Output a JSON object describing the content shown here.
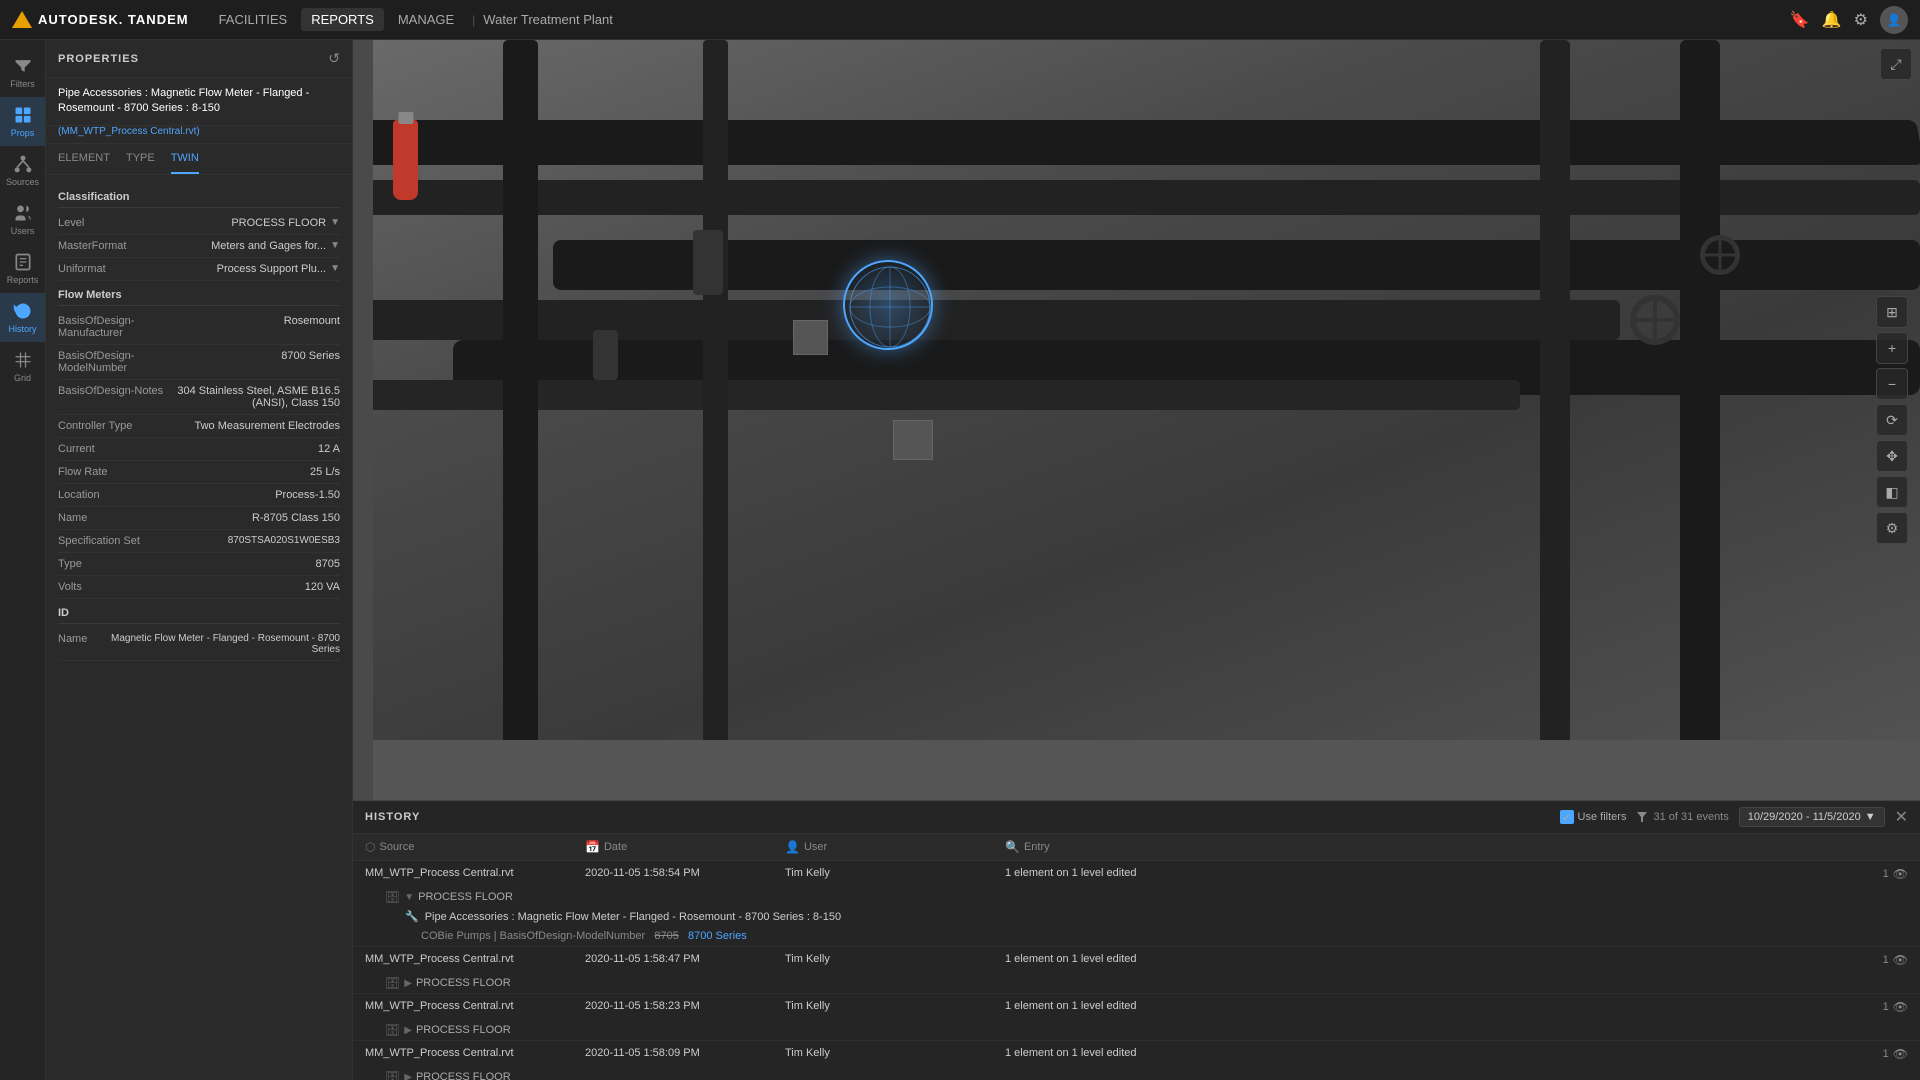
{
  "app": {
    "logo": "AUTODESK. TANDEM",
    "nav_links": [
      {
        "label": "FACILITIES",
        "active": false
      },
      {
        "label": "REPORTS",
        "active": false
      },
      {
        "label": "MANAGE",
        "active": false
      }
    ],
    "facility_name": "Water Treatment Plant"
  },
  "sidebar": {
    "items": [
      {
        "label": "Filters",
        "icon": "filter-icon",
        "active": false
      },
      {
        "label": "Props",
        "icon": "props-icon",
        "active": true
      },
      {
        "label": "Sources",
        "icon": "sources-icon",
        "active": false
      },
      {
        "label": "Users",
        "icon": "users-icon",
        "active": false
      },
      {
        "label": "Reports",
        "icon": "reports-icon",
        "active": false
      },
      {
        "label": "History",
        "icon": "history-icon",
        "active": true
      },
      {
        "label": "Grid",
        "icon": "grid-icon",
        "active": false
      }
    ]
  },
  "properties": {
    "panel_title": "PROPERTIES",
    "element_name": "Pipe Accessories : Magnetic Flow Meter - Flanged - Rosemount - 8700 Series : 8-150",
    "file_name": "(MM_WTP_Process Central.rvt)",
    "tabs": [
      "ELEMENT",
      "TYPE",
      "TWIN"
    ],
    "active_tab": "TWIN",
    "sections": [
      {
        "title": "Classification",
        "fields": [
          {
            "label": "Level",
            "value": "PROCESS FLOOR",
            "dropdown": true
          },
          {
            "label": "MasterFormat",
            "value": "Meters and Gages for...",
            "dropdown": true
          },
          {
            "label": "Uniformat",
            "value": "Process Support Plu...",
            "dropdown": true
          }
        ]
      },
      {
        "title": "Flow Meters",
        "fields": [
          {
            "label": "BasisOfDesign-Manufacturer",
            "value": "Rosemount",
            "dropdown": false
          },
          {
            "label": "BasisOfDesign-ModelNumber",
            "value": "8700 Series",
            "dropdown": false
          },
          {
            "label": "BasisOfDesign-Notes",
            "value": "304 Stainless Steel, ASME B16.5 (ANSI), Class 150",
            "dropdown": false
          },
          {
            "label": "Controller Type",
            "value": "Two Measurement Electrodes",
            "dropdown": false
          },
          {
            "label": "Current",
            "value": "12 A",
            "dropdown": false
          },
          {
            "label": "Flow Rate",
            "value": "25 L/s",
            "dropdown": false
          },
          {
            "label": "Location",
            "value": "Process-1.50",
            "dropdown": false
          },
          {
            "label": "Name",
            "value": "R-8705 Class 150",
            "dropdown": false
          },
          {
            "label": "Specification Set",
            "value": "870STSA020S1W0ESB3",
            "dropdown": false
          },
          {
            "label": "Type",
            "value": "8705",
            "dropdown": false
          },
          {
            "label": "Volts",
            "value": "120 VA",
            "dropdown": false
          }
        ]
      },
      {
        "title": "ID",
        "fields": [
          {
            "label": "Name",
            "value": "Magnetic Flow Meter - Flanged - Rosemount - 8700 Series",
            "dropdown": false
          }
        ]
      }
    ]
  },
  "history": {
    "panel_title": "HISTORY",
    "use_filters_label": "Use filters",
    "events_count": "31 of 31 events",
    "date_range": "10/29/2020 - 11/5/2020",
    "columns": [
      {
        "label": "Source",
        "icon": "source-col-icon"
      },
      {
        "label": "Date",
        "icon": "date-col-icon"
      },
      {
        "label": "User",
        "icon": "user-col-icon"
      },
      {
        "label": "Entry",
        "icon": "search-col-icon"
      }
    ],
    "rows": [
      {
        "source": "MM_WTP_Process Central.rvt",
        "date": "2020-11-05 1:58:54 PM",
        "user": "Tim Kelly",
        "entry": "1 element on 1 level edited",
        "count": "1",
        "sub_level": "PROCESS FLOOR",
        "sub_element": "Pipe Accessories : Magnetic Flow Meter - Flanged - Rosemount - 8700 Series : 8-150",
        "detail_label": "COBie Pumps | BasisOfDesign-ModelNumber",
        "detail_old": "8705",
        "detail_new": "8700 Series"
      },
      {
        "source": "MM_WTP_Process Central.rvt",
        "date": "2020-11-05 1:58:47 PM",
        "user": "Tim Kelly",
        "entry": "1 element on 1 level edited",
        "count": "1",
        "sub_level": "PROCESS FLOOR",
        "sub_element": null,
        "detail_label": null,
        "detail_old": null,
        "detail_new": null
      },
      {
        "source": "MM_WTP_Process Central.rvt",
        "date": "2020-11-05 1:58:23 PM",
        "user": "Tim Kelly",
        "entry": "1 element on 1 level edited",
        "count": "1",
        "sub_level": "PROCESS FLOOR",
        "sub_element": null,
        "detail_label": null,
        "detail_old": null,
        "detail_new": null
      },
      {
        "source": "MM_WTP_Process Central.rvt",
        "date": "2020-11-05 1:58:09 PM",
        "user": "Tim Kelly",
        "entry": "1 element on 1 level edited",
        "count": "1",
        "sub_level": "PROCESS FLOOR",
        "sub_element": null,
        "detail_label": null,
        "detail_old": null,
        "detail_new": null
      }
    ]
  }
}
